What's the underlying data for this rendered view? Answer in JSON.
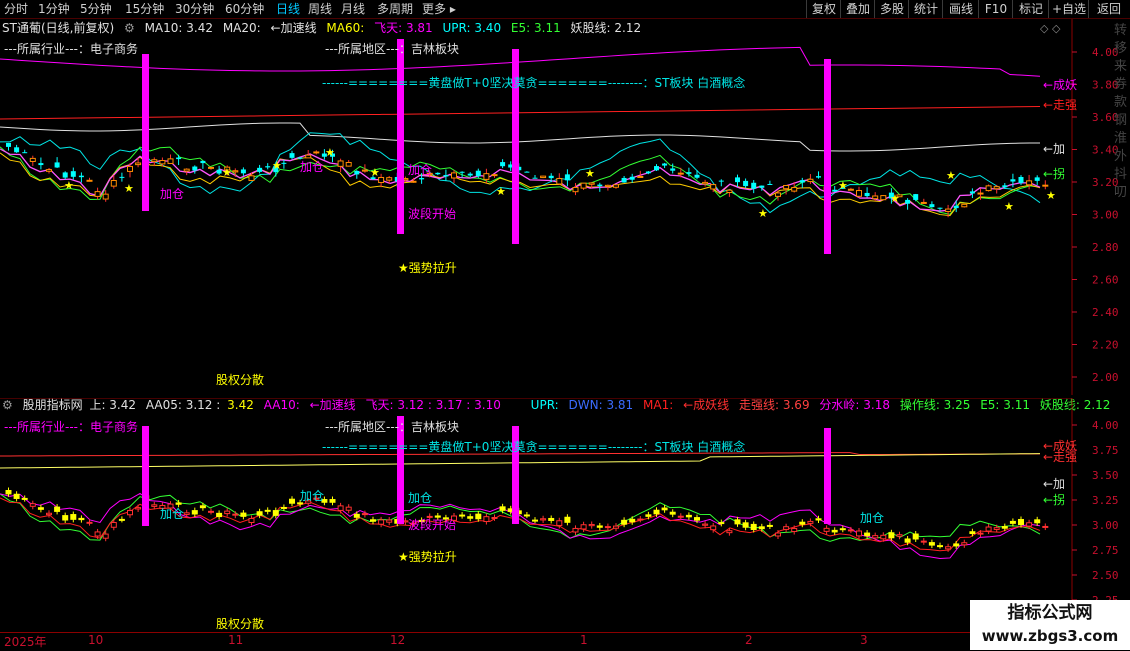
{
  "toolbar": {
    "periods": [
      "分时",
      "1分钟",
      "5分钟",
      "15分钟",
      "30分钟",
      "60分钟",
      "日线",
      "周线",
      "月线",
      "多周期",
      "更多 ▸"
    ],
    "active_period": "日线",
    "right_buttons": [
      "复权",
      "叠加",
      "多股",
      "统计",
      "画线",
      "F10",
      "标记",
      "+自选",
      "返回"
    ]
  },
  "main_header": {
    "stock": "ST通葡(日线,前复权)",
    "ma10": "MA10: 3.42",
    "ma20": "MA20:",
    "accel": "←加速线",
    "ma60": "MA60:",
    "feitian": "飞天: 3.81",
    "upr": "UPR: 3.40",
    "e5": "E5: 3.11",
    "yaogu": "妖股线: 2.12"
  },
  "sub_header": {
    "name": "股朋指标网",
    "shang": "上: 3.42",
    "aa05": "AA05: 3.12 :",
    "aa05b": "3.42",
    "aa10": "AA10:",
    "accel": "←加速线",
    "feitian": "飞天: 3.12 : 3.17 : 3.10",
    "upr": "UPR:",
    "dwn": "DWN: 3.81",
    "ma1": "MA1:",
    "chengyao": "←成妖线",
    "zouqiang": "走强线: 3.69",
    "fenshui": "分水岭: 3.18",
    "caozuo": "操作线: 3.25",
    "e5": "E5: 3.11",
    "yaogu": "妖股线: 2.12"
  },
  "annotations": {
    "industry": "---所属行业---：电子商务",
    "region": "---所属地区---：吉林板块",
    "concept": "------========黄盘做T+0坚决莫贪=======--------：ST板块 白酒概念",
    "jiacang": "加仓",
    "boduan": "波段开始",
    "qiangshi": "★强势拉升",
    "guquan": "股权分散",
    "line_chengyao": "←成妖",
    "line_zouqiang": "←走强",
    "line_jia": "←加",
    "line_guai": "←拐"
  },
  "main_yaxis": [
    "4.00",
    "3.80",
    "3.60",
    "3.40",
    "3.20",
    "3.00",
    "2.80",
    "2.60",
    "2.40",
    "2.20",
    "2.00"
  ],
  "sub_yaxis": [
    "4.00",
    "3.75",
    "3.50",
    "3.25",
    "3.00",
    "2.75",
    "2.50",
    "2.25"
  ],
  "date_labels": [
    "2025年",
    "10",
    "11",
    "12",
    "1",
    "2",
    "3"
  ],
  "right_concepts": "转移来券款钢淮外抖叨",
  "watermark": {
    "line1": "指标公式网",
    "line2": "www.zbgs3.com"
  },
  "colors": {
    "up": "#ff3030",
    "down": "#00ffff",
    "magenta": "#ff00ff",
    "yellow": "#ffff00",
    "axis": "#c8102e"
  }
}
